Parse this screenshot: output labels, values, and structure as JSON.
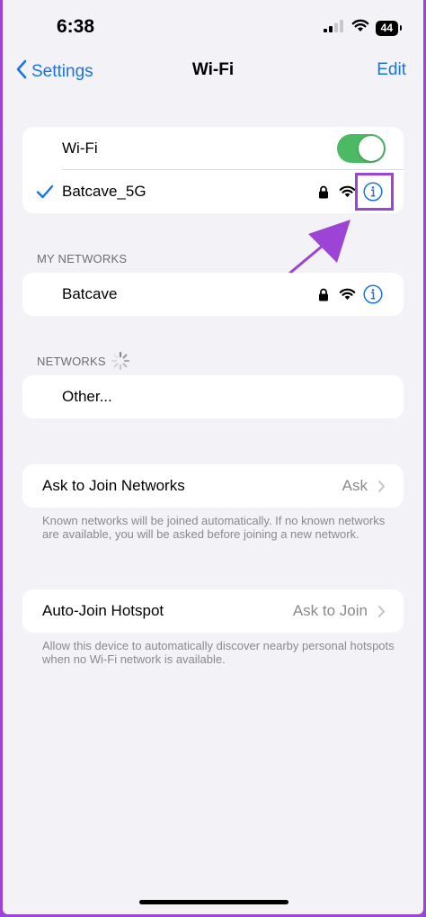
{
  "status_bar": {
    "time": "6:38",
    "battery": "44"
  },
  "nav": {
    "back_label": "Settings",
    "title": "Wi-Fi",
    "edit_label": "Edit"
  },
  "wifi_group": {
    "toggle_label": "Wi-Fi",
    "toggle_on": true,
    "connected_network": "Batcave_5G"
  },
  "my_networks": {
    "header": "MY NETWORKS",
    "items": [
      {
        "name": "Batcave"
      }
    ]
  },
  "networks": {
    "header": "NETWORKS",
    "other_label": "Other..."
  },
  "ask_to_join": {
    "label": "Ask to Join Networks",
    "value": "Ask",
    "footer": "Known networks will be joined automatically. If no known networks are available, you will be asked before joining a new network."
  },
  "auto_join": {
    "label": "Auto-Join Hotspot",
    "value": "Ask to Join",
    "footer": "Allow this device to automatically discover nearby personal hotspots when no Wi-Fi network is available."
  },
  "colors": {
    "accent": "#1a73e8",
    "toggle_on": "#4cb964",
    "annotation": "#9b44d6"
  },
  "icons": [
    "back-chevron-icon",
    "checkmark-icon",
    "lock-icon",
    "wifi-icon",
    "info-icon",
    "chevron-right-icon",
    "spinner-icon",
    "annotation-arrow-icon"
  ]
}
